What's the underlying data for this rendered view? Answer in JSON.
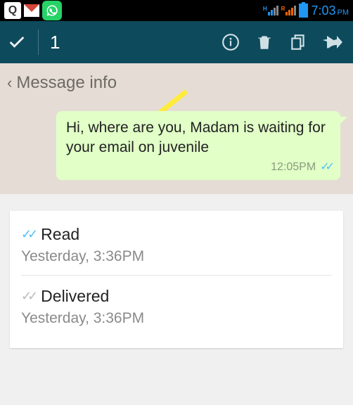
{
  "status": {
    "time": "7:03",
    "ampm": "PM",
    "net_a_label": "H",
    "net_b_label": "R"
  },
  "action": {
    "selected_count": "1"
  },
  "header": {
    "title": "Message info"
  },
  "message": {
    "text": "Hi, where are you, Madam is waiting for your email on juvenile",
    "time": "12:05PM"
  },
  "info": {
    "read": {
      "label": "Read",
      "time": "Yesterday, 3:36PM"
    },
    "delivered": {
      "label": "Delivered",
      "time": "Yesterday, 3:36PM"
    }
  }
}
